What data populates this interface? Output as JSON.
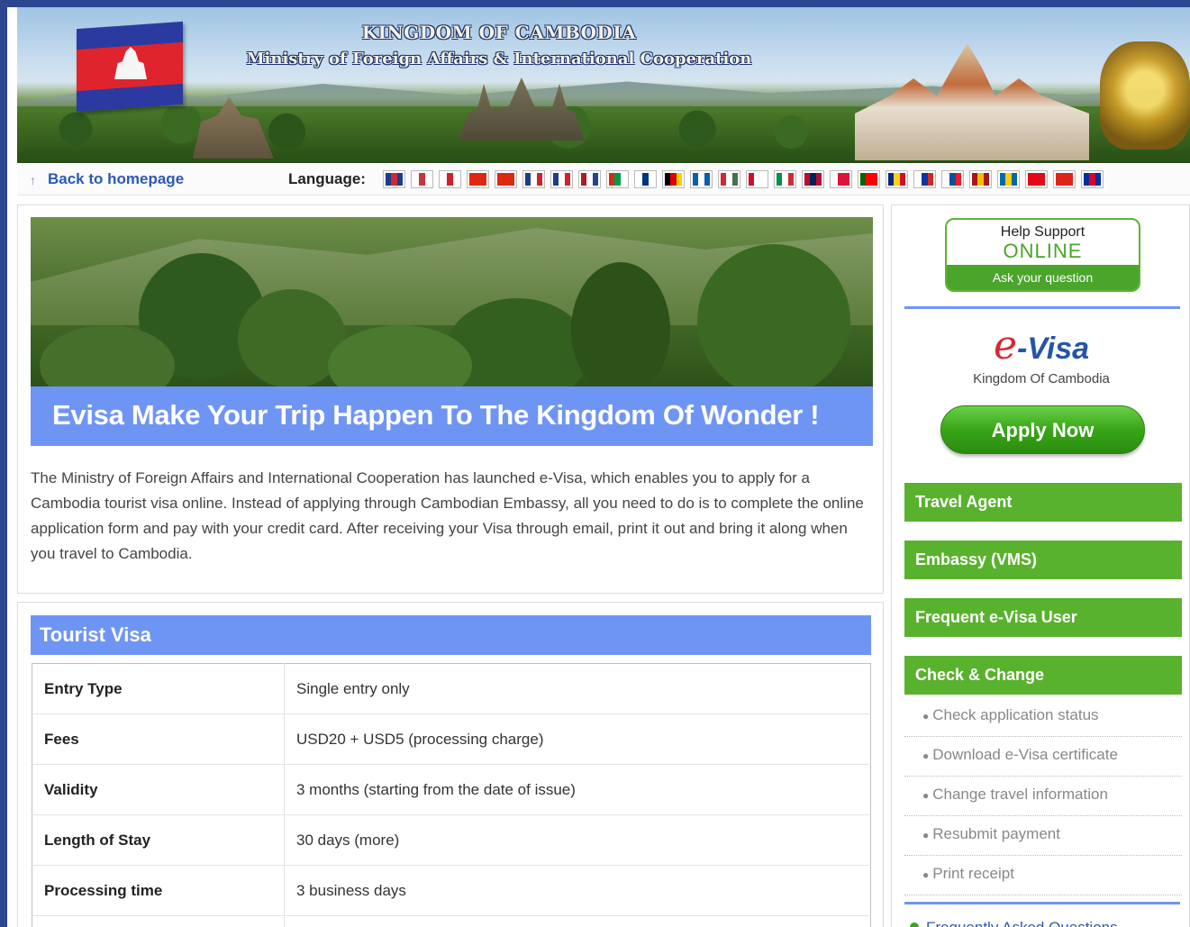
{
  "banner": {
    "title_line1": "KINGDOM OF CAMBODIA",
    "title_line2": "Ministry of Foreign Affairs & International Cooperation"
  },
  "nav": {
    "back_label": "Back to homepage",
    "back_icon": "home-arrow-icon",
    "language_label": "Language:",
    "languages": [
      {
        "name": "english",
        "colors": [
          "#1f3b8c",
          "#cc2936",
          "#1f3b8c"
        ]
      },
      {
        "name": "korean",
        "colors": [
          "#ffffff",
          "#c9363b",
          "#ffffff"
        ]
      },
      {
        "name": "japanese",
        "colors": [
          "#ffffff",
          "#d0222a",
          "#ffffff"
        ]
      },
      {
        "name": "chinese-simplified",
        "colors": [
          "#de2910",
          "#de2910",
          "#de2910"
        ]
      },
      {
        "name": "chinese-traditional",
        "colors": [
          "#de2910",
          "#de2910",
          "#de2910"
        ]
      },
      {
        "name": "french",
        "colors": [
          "#1f3b8c",
          "#ffffff",
          "#d0222a"
        ]
      },
      {
        "name": "czech",
        "colors": [
          "#1f3b8c",
          "#ffffff",
          "#d0222a"
        ]
      },
      {
        "name": "dutch",
        "colors": [
          "#ae1c28",
          "#ffffff",
          "#21468b"
        ]
      },
      {
        "name": "basque",
        "colors": [
          "#d52b1e",
          "#009b48",
          "#ffffff"
        ]
      },
      {
        "name": "finnish",
        "colors": [
          "#ffffff",
          "#003580",
          "#ffffff"
        ]
      },
      {
        "name": "german",
        "colors": [
          "#000000",
          "#dd0000",
          "#ffce00"
        ]
      },
      {
        "name": "greek",
        "colors": [
          "#0d5eaf",
          "#ffffff",
          "#0d5eaf"
        ]
      },
      {
        "name": "hungarian",
        "colors": [
          "#ce2939",
          "#ffffff",
          "#477050"
        ]
      },
      {
        "name": "indonesian",
        "colors": [
          "#ce1126",
          "#ffffff",
          "#ffffff"
        ]
      },
      {
        "name": "italian",
        "colors": [
          "#009246",
          "#ffffff",
          "#ce2b37"
        ]
      },
      {
        "name": "norwegian",
        "colors": [
          "#ba0c2f",
          "#00205b",
          "#ba0c2f"
        ]
      },
      {
        "name": "polish",
        "colors": [
          "#ffffff",
          "#dc143c",
          "#dc143c"
        ]
      },
      {
        "name": "portuguese",
        "colors": [
          "#006600",
          "#ff0000",
          "#ff0000"
        ]
      },
      {
        "name": "romanian",
        "colors": [
          "#002b7f",
          "#fcd116",
          "#ce1126"
        ]
      },
      {
        "name": "russian",
        "colors": [
          "#ffffff",
          "#0039a6",
          "#d52b1e"
        ]
      },
      {
        "name": "slovak",
        "colors": [
          "#ffffff",
          "#0b4ea2",
          "#ee1c25"
        ]
      },
      {
        "name": "spanish",
        "colors": [
          "#aa151b",
          "#f1bf00",
          "#aa151b"
        ]
      },
      {
        "name": "swedish",
        "colors": [
          "#006aa7",
          "#fecc00",
          "#006aa7"
        ]
      },
      {
        "name": "turkish",
        "colors": [
          "#e30a17",
          "#e30a17",
          "#e30a17"
        ]
      },
      {
        "name": "vietnamese",
        "colors": [
          "#da251d",
          "#da251d",
          "#da251d"
        ]
      },
      {
        "name": "khmer",
        "colors": [
          "#032ea1",
          "#e00025",
          "#032ea1"
        ]
      }
    ]
  },
  "main": {
    "hero_title": "Evisa Make Your Trip Happen To The Kingdom Of Wonder !",
    "intro": "The Ministry of Foreign Affairs and International Cooperation has launched e-Visa, which enables you to apply for a Cambodia tourist visa online. Instead of applying through Cambodian Embassy, all you need to do is to complete the online application form and pay with your credit card. After receiving your Visa through email, print it out and bring it along when you travel to Cambodia."
  },
  "tourist_visa": {
    "heading": "Tourist Visa",
    "rows": [
      {
        "key": "Entry Type",
        "value": "Single entry only"
      },
      {
        "key": "Fees",
        "value": "USD20 + USD5 (processing charge)"
      },
      {
        "key": "Validity",
        "value": "3 months (starting from the date of issue)"
      },
      {
        "key": "Length of Stay",
        "value": "30 days (more)"
      },
      {
        "key": "Processing time",
        "value": "3 business days"
      },
      {
        "key": "",
        "value": ""
      }
    ]
  },
  "sidebar": {
    "help": {
      "line1": "Help Support",
      "line2": "ONLINE",
      "line3": "Ask your question"
    },
    "evisa_logo": {
      "e": "e",
      "rest": "-Visa",
      "subtitle": "Kingdom Of Cambodia"
    },
    "apply_label": "Apply Now",
    "travel_agent": "Travel Agent",
    "embassy": "Embassy (VMS)",
    "frequent_user": "Frequent e-Visa User",
    "check_change": "Check & Change",
    "sub_links": [
      "Check application status",
      "Download e-Visa certificate",
      "Change travel information",
      "Resubmit payment",
      "Print receipt"
    ],
    "faq": "Frequently Asked Questions"
  },
  "colors": {
    "accent_blue": "#6f95f4",
    "button_green": "#59b22e",
    "link_blue": "#2a59b5"
  }
}
